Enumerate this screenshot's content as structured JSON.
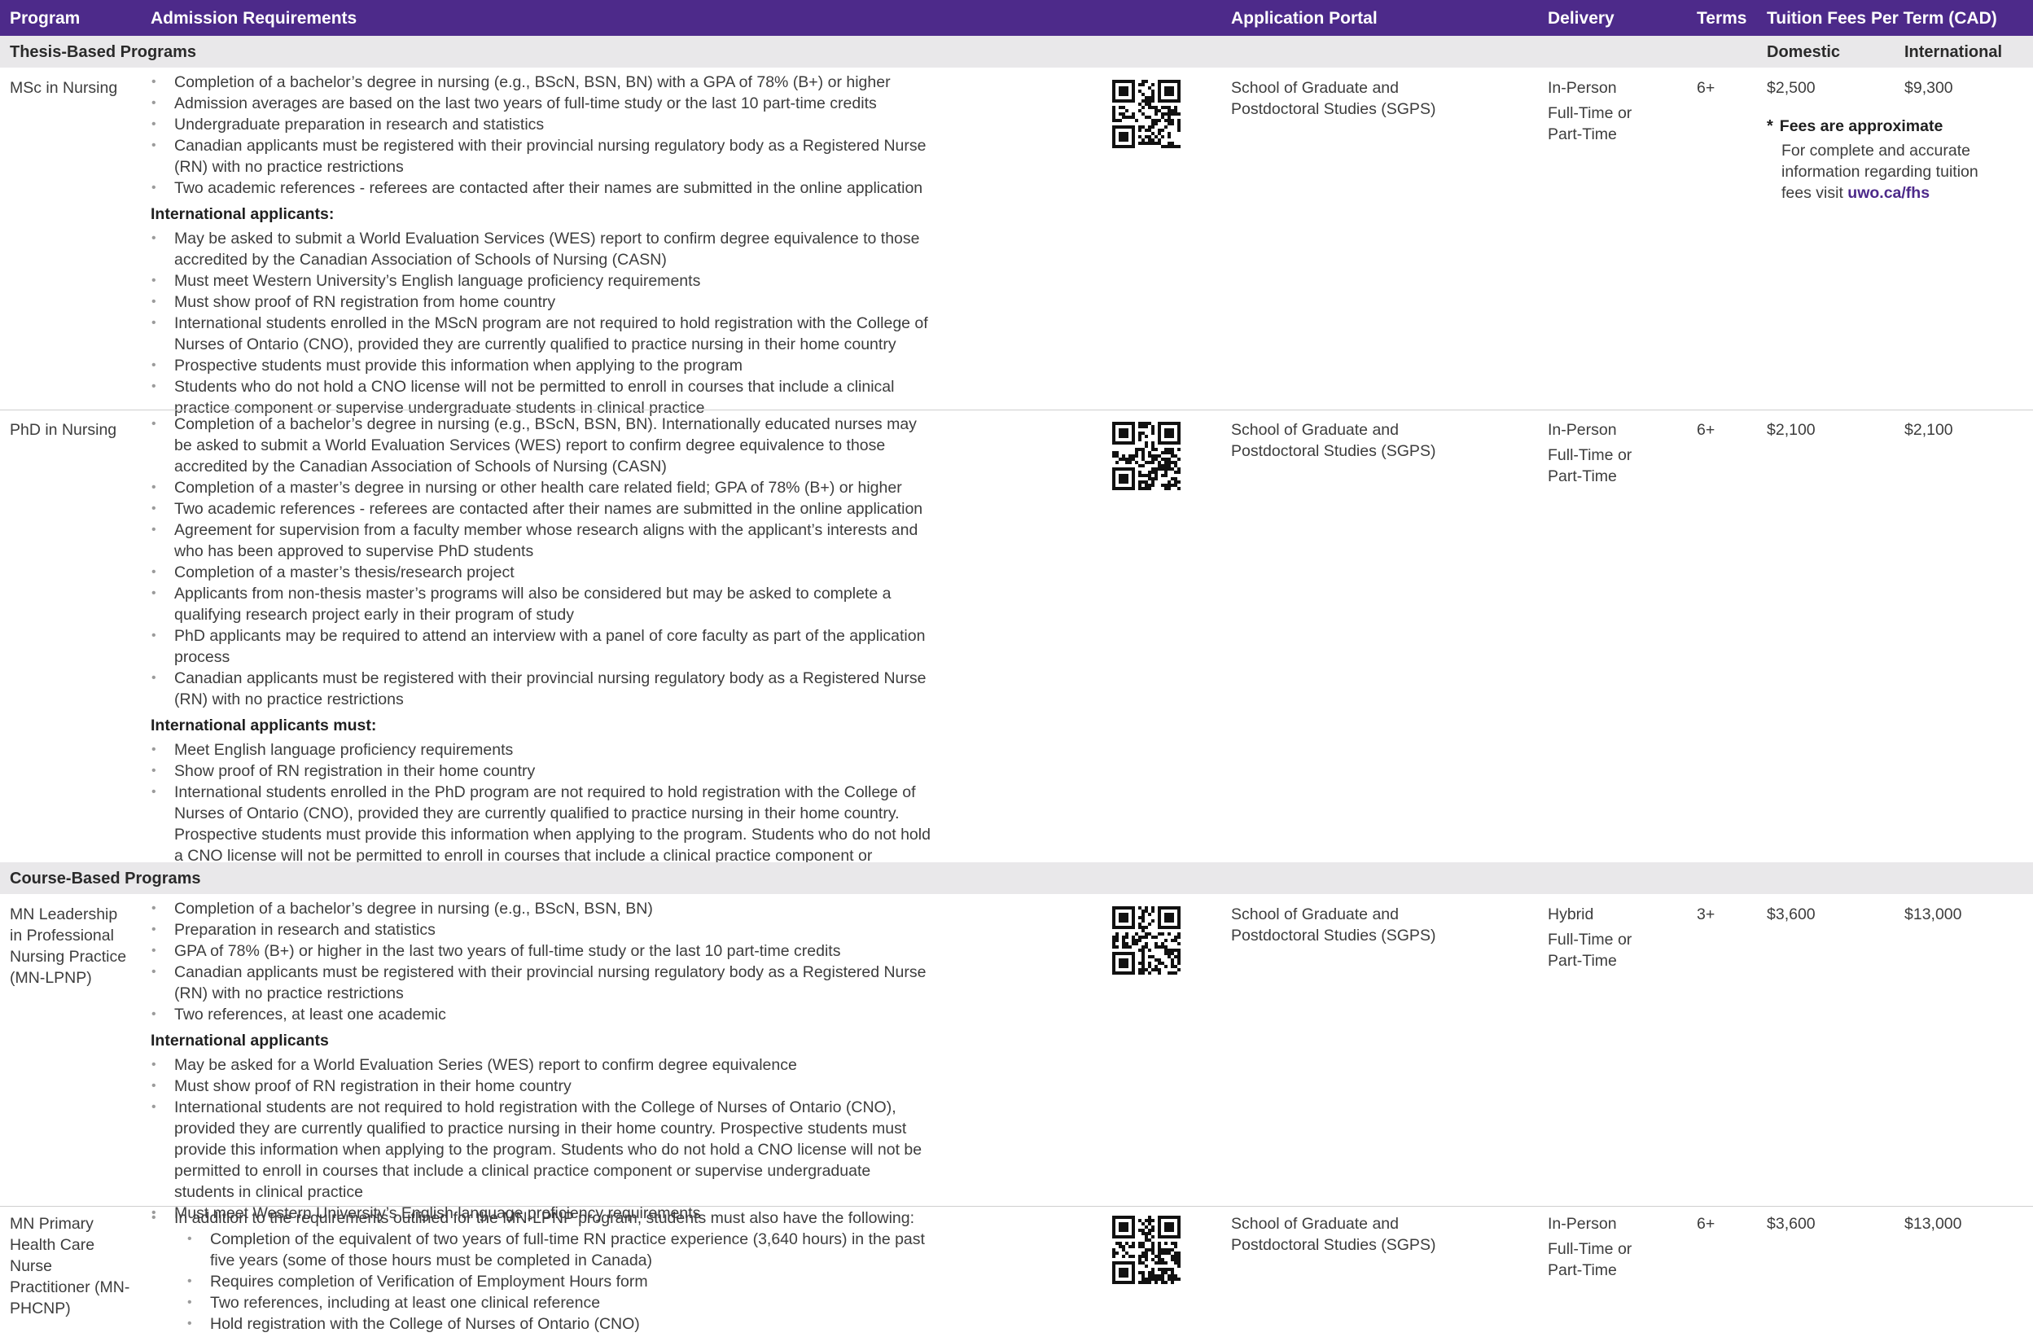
{
  "headers": {
    "program": "Program",
    "admission": "Admission Requirements",
    "portal": "Application Portal",
    "delivery": "Delivery",
    "terms": "Terms",
    "tuition": "Tuition Fees Per Term (CAD)"
  },
  "sections": {
    "thesis": "Thesis-Based Programs",
    "course": "Course-Based Programs",
    "domestic": "Domestic",
    "international": "International"
  },
  "icons": {
    "qr": "qr-code-icon"
  },
  "colors": {
    "brand": "#4d2a8a",
    "band": "#e9e8ea"
  },
  "fees_note": {
    "mark": "*",
    "title": "Fees are approximate",
    "text": "For complete and accurate information regarding tuition fees visit",
    "link": "uwo.ca/fhs"
  },
  "programs": [
    {
      "name": "MSc in Nursing",
      "requirements": [
        "Completion of a bachelor’s degree in nursing (e.g., BScN, BSN, BN) with a GPA of 78% (B+) or higher",
        "Admission averages are based on the last two years of full-time study or the last 10 part-time credits",
        "Undergraduate preparation in research and statistics",
        "Canadian applicants must be registered with their provincial nursing regulatory body as a Registered Nurse (RN) with no practice restrictions",
        "Two academic references - referees are contacted after their names are submitted in the online application"
      ],
      "intl_heading": "International applicants:",
      "intl_requirements": [
        "May be asked to submit a World Evaluation Services (WES) report to confirm degree equivalence to those accredited by the Canadian Association of Schools of Nursing (CASN)",
        "Must meet Western University’s English language proficiency requirements",
        "Must show proof of RN registration from home country",
        "International students enrolled in the MScN program are not required to hold registration with the College of Nurses of Ontario (CNO), provided they are currently qualified to practice nursing in their home country",
        "Prospective students must provide this information when applying to the program",
        "Students who do not hold a CNO license will not be permitted to enroll in courses that include a clinical practice component or supervise undergraduate students in clinical practice"
      ],
      "portal": "School of Graduate and Postdoctoral Studies (SGPS)",
      "delivery_mode": "In-Person",
      "delivery_time": "Full-Time or Part-Time",
      "terms": "6+",
      "domestic": "$2,500",
      "international": "$9,300"
    },
    {
      "name": "PhD in Nursing",
      "requirements": [
        "Completion of a bachelor’s degree in nursing (e.g., BScN, BSN, BN). Internationally educated nurses may be asked to submit a World Evaluation Services (WES) report to confirm degree equivalence to those accredited by the Canadian Association of Schools of Nursing (CASN)",
        "Completion of a master’s degree in nursing or other health care related field; GPA of 78% (B+) or higher",
        "Two academic references - referees are contacted after their names are submitted in the online application",
        "Agreement for supervision from a faculty member whose research aligns with the applicant’s interests and who has been approved to supervise PhD students",
        "Completion of a master’s thesis/research project",
        "Applicants from non-thesis master’s programs will also be considered but may be asked to complete a qualifying research project early in their program of study",
        "PhD applicants may be required to attend an interview with a panel of core faculty as part of the application process",
        "Canadian applicants must be registered with their provincial nursing regulatory body as a Registered Nurse (RN) with no practice restrictions"
      ],
      "intl_heading": "International applicants must:",
      "intl_requirements": [
        "Meet English language proficiency requirements",
        "Show proof of RN registration in their home country",
        "International students enrolled in the PhD program are not required to hold registration with the College of Nurses of Ontario (CNO), provided they are currently qualified to practice nursing in their home country. Prospective students must provide this information when applying to the program. Students who do not hold a CNO license will not be permitted to enroll in courses that include a clinical practice component or supervise undergraduate students in clinical practice"
      ],
      "portal": "School of Graduate and Postdoctoral Studies (SGPS)",
      "delivery_mode": "In-Person",
      "delivery_time": "Full-Time or Part-Time",
      "terms": "6+",
      "domestic": "$2,100",
      "international": "$2,100"
    },
    {
      "name": "MN Leadership in Professional Nursing Practice (MN-LPNP)",
      "requirements": [
        "Completion of a bachelor’s degree in nursing (e.g., BScN, BSN, BN)",
        "Preparation in research and statistics",
        "GPA of 78% (B+) or higher in the last two years of full-time study or the last 10 part-time credits",
        "Canadian applicants must be registered with their provincial nursing regulatory body as a Registered Nurse (RN) with no practice restrictions",
        "Two references, at least one academic"
      ],
      "intl_heading": "International applicants",
      "intl_requirements": [
        "May be asked for a World Evaluation Series (WES) report to confirm degree equivalence",
        "Must show proof of RN registration in their home country",
        "International students are not required to hold registration with the College of Nurses of Ontario (CNO), provided they are currently qualified to practice nursing in their home country. Prospective students must provide this information when applying to the program. Students who do not hold a CNO license will not be permitted to enroll in courses that include a clinical practice component or supervise undergraduate students in clinical practice",
        "Must meet Western University’s English language proficiency requirements"
      ],
      "portal": "School of Graduate and Postdoctoral Studies (SGPS)",
      "delivery_mode": "Hybrid",
      "delivery_time": "Full-Time or Part-Time",
      "terms": "3+",
      "domestic": "$3,600",
      "international": "$13,000"
    },
    {
      "name": "MN Primary Health Care Nurse Practitioner (MN-PHCNP)",
      "requirements": [
        "In addition to the requirements outlined for the MN-LPNP program, students must also have the following:"
      ],
      "sub_requirements": [
        "Completion of the equivalent of two years of full-time RN practice experience (3,640 hours) in the past five years (some of those hours must be completed in Canada)",
        "Requires completion of Verification of Employment Hours form",
        "Two references, including at least one clinical reference",
        "Hold registration with the College of Nurses of Ontario (CNO)"
      ],
      "portal": "School of Graduate and Postdoctoral Studies (SGPS)",
      "delivery_mode": "In-Person",
      "delivery_time": "Full-Time or Part-Time",
      "terms": "6+",
      "domestic": "$3,600",
      "international": "$13,000"
    }
  ]
}
